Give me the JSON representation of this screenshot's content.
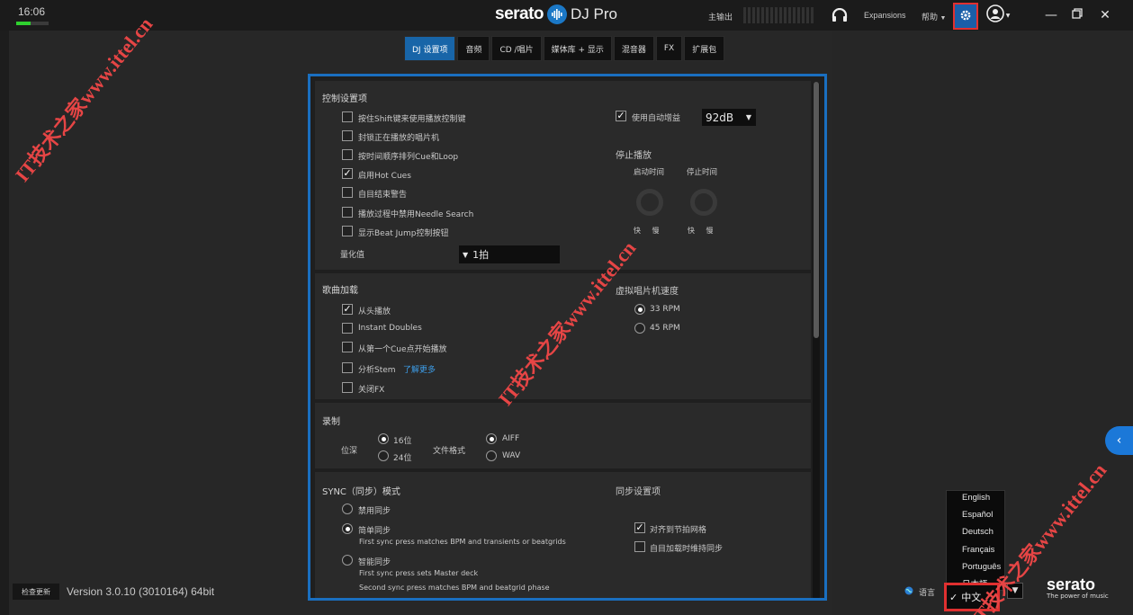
{
  "clock": "16:06",
  "app": {
    "brand": "serato",
    "product": "DJ Pro"
  },
  "topbar": {
    "master_out": "主输出",
    "expansions": "Expansions",
    "help": "帮助"
  },
  "tabs": [
    "DJ 设置项",
    "音频",
    "CD /唱片",
    "媒体库 + 显示",
    "混音器",
    "FX",
    "扩展包"
  ],
  "active_tab": 0,
  "sections": {
    "control": {
      "title": "控制设置项",
      "options": [
        {
          "label": "按住Shift键来使用播放控制键",
          "checked": false
        },
        {
          "label": "封锁正在播放的唱片机",
          "checked": false
        },
        {
          "label": "按时间顺序排列Cue和Loop",
          "checked": false
        },
        {
          "label": "启用Hot Cues",
          "checked": true
        },
        {
          "label": "自目结束警告",
          "checked": false
        },
        {
          "label": "播放过程中禁用Needle Search",
          "checked": false
        },
        {
          "label": "显示Beat Jump控制按钮",
          "checked": false
        }
      ],
      "quantize_label": "量化值",
      "quantize_value": "1拍",
      "auto_gain_label": "使用自动增益",
      "auto_gain_checked": true,
      "auto_gain_value": "92dB",
      "stop_title": "停止播放",
      "start_time_label": "启动时间",
      "stop_time_label": "停止时间",
      "knob1_label": "快 慢",
      "knob2_label": "快 慢"
    },
    "track_load": {
      "title": "歌曲加载",
      "options": [
        {
          "label": "从头播放",
          "checked": true
        },
        {
          "label": "Instant Doubles",
          "checked": false
        },
        {
          "label": "从第一个Cue点开始播放",
          "checked": false
        },
        {
          "label": "分析Stem",
          "checked": false,
          "link": "了解更多"
        },
        {
          "label": "关闭FX",
          "checked": false
        }
      ],
      "speed_title": "虚拟唱片机速度",
      "speeds": [
        {
          "label": "33 RPM",
          "on": true
        },
        {
          "label": "45 RPM",
          "on": false
        }
      ]
    },
    "record": {
      "title": "录制",
      "bit_depth_label": "位深",
      "bit_depths": [
        {
          "label": "16位",
          "on": true
        },
        {
          "label": "24位",
          "on": false
        }
      ],
      "format_label": "文件格式",
      "formats": [
        {
          "label": "AIFF",
          "on": true
        },
        {
          "label": "WAV",
          "on": false
        }
      ]
    },
    "sync": {
      "title": "SYNC（同步）模式",
      "modes": [
        {
          "label": "禁用同步",
          "on": false,
          "desc": []
        },
        {
          "label": "简单同步",
          "on": true,
          "desc": [
            "First sync press matches BPM and transients or beatgrids"
          ]
        },
        {
          "label": "智能同步",
          "on": false,
          "desc": [
            "First sync press sets Master deck",
            "Second sync press matches BPM and beatgrid phase"
          ]
        }
      ],
      "settings_title": "同步设置项",
      "settings": [
        {
          "label": "对齐到节拍网格",
          "checked": true
        },
        {
          "label": "自目加载时维持同步",
          "checked": false
        }
      ]
    }
  },
  "bottom": {
    "check_updates": "检查更新",
    "version": "Version 3.0.10 (3010164) 64bit",
    "language_label": "语言"
  },
  "languages": [
    "English",
    "Español",
    "Deutsch",
    "Français",
    "Português",
    "日本語"
  ],
  "current_language": "中文",
  "serato_tagline": "The power of music",
  "watermarks": [
    "IT技术之家www.ittel.cn",
    "IT技术之家www.ittel.cn",
    "IT技术之家www.ittel.cn"
  ]
}
